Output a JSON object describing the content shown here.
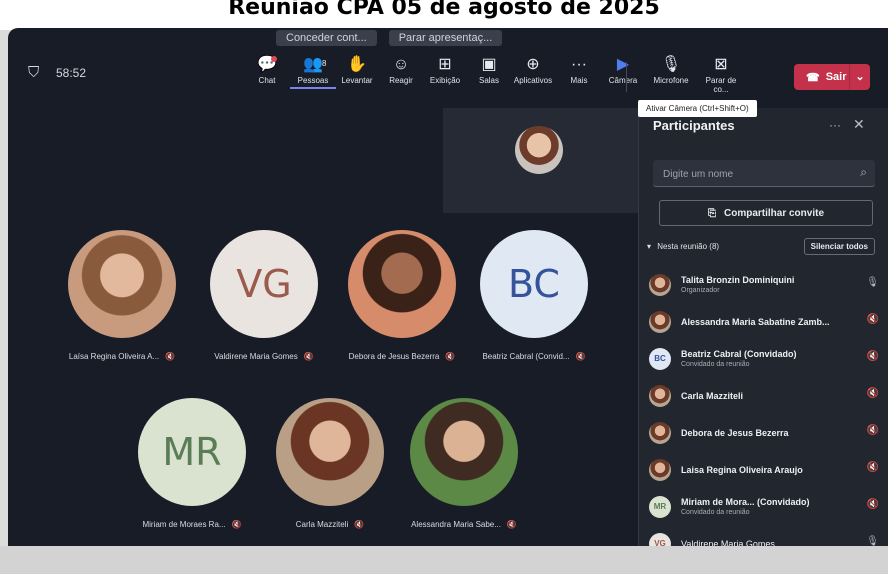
{
  "page": {
    "title": "Reunião CPA 05 de agosto de 2025"
  },
  "share_bar": {
    "left_text": "Conceder cont...",
    "stop_label": "Parar apresentaç...",
    "link_text": ""
  },
  "topbar": {
    "timer": "58:52",
    "buttons": [
      {
        "label": "Chat",
        "icon": "chat-icon",
        "glyph": "💬"
      },
      {
        "label": "Pessoas",
        "icon": "people-icon",
        "glyph": "👥",
        "badge": "8"
      },
      {
        "label": "Levantar",
        "icon": "raise-hand-icon",
        "glyph": "✋"
      },
      {
        "label": "Reagir",
        "icon": "react-icon",
        "glyph": "☺"
      },
      {
        "label": "Exibição",
        "icon": "view-icon",
        "glyph": "⊞"
      },
      {
        "label": "Salas",
        "icon": "rooms-icon",
        "glyph": "▣"
      },
      {
        "label": "Aplicativos",
        "icon": "apps-icon",
        "glyph": "⊕"
      },
      {
        "label": "Mais",
        "icon": "more-icon",
        "glyph": "···"
      },
      {
        "label": "Câmera",
        "icon": "camera-icon",
        "glyph": "▶"
      },
      {
        "label": "Microfone",
        "icon": "microphone-icon",
        "glyph": "🎙"
      },
      {
        "label": "Parar de co...",
        "icon": "stop-share-icon",
        "glyph": "⊠"
      }
    ],
    "leave_label": "Sair",
    "tooltip": "Ativar Câmera (Ctrl+Shift+O)"
  },
  "participants_grid": {
    "row1": [
      {
        "name": "Laísa Regina Oliveira A...",
        "type": "photo1",
        "initials": ""
      },
      {
        "name": "Valdirene Maria Gomes",
        "type": "vg",
        "initials": "VG"
      },
      {
        "name": "Debora de Jesus Bezerra",
        "type": "photo2",
        "initials": ""
      },
      {
        "name": "Beatriz Cabral (Convid...",
        "type": "bc",
        "initials": "BC"
      }
    ],
    "row2": [
      {
        "name": "Miriam de Moraes Ra...",
        "type": "mr",
        "initials": "MR"
      },
      {
        "name": "Carla Mazziteli",
        "type": "photo3",
        "initials": ""
      },
      {
        "name": "Alessandra Maria Sabe...",
        "type": "photo4",
        "initials": ""
      }
    ]
  },
  "panel": {
    "title": "Participantes",
    "search_placeholder": "Digite um nome",
    "invite_label": "Compartilhar convite",
    "section_label": "Nesta reunião (8)",
    "mute_all_label": "Silenciar todos",
    "participants": [
      {
        "name": "Talita Bronzin Dominiquini",
        "sub": "Organizador",
        "avatar": "ph",
        "initials": "",
        "status_icon": "mic-on-icon",
        "glyph": "🎙"
      },
      {
        "name": "Alessandra Maria Sabatine Zamb...",
        "sub": "",
        "avatar": "ph",
        "initials": "",
        "status_icon": "mic-off-icon",
        "glyph": "🔇"
      },
      {
        "name": "Beatriz Cabral (Convidado)",
        "sub": "Convidado da reunião",
        "avatar": "init-bc",
        "initials": "BC",
        "status_icon": "mic-off-icon",
        "glyph": "🔇"
      },
      {
        "name": "Carla Mazziteli",
        "sub": "",
        "avatar": "ph",
        "initials": "",
        "status_icon": "mic-off-icon",
        "glyph": "🔇"
      },
      {
        "name": "Debora de Jesus Bezerra",
        "sub": "",
        "avatar": "ph",
        "initials": "",
        "status_icon": "mic-off-icon",
        "glyph": "🔇"
      },
      {
        "name": "Laisa Regina Oliveira Araujo",
        "sub": "",
        "avatar": "ph",
        "initials": "",
        "status_icon": "mic-off-icon",
        "glyph": "🔇"
      },
      {
        "name": "Miriam de Mora... (Convidado)",
        "sub": "Convidado da reunião",
        "avatar": "init-mr",
        "initials": "MR",
        "status_icon": "mic-off-icon",
        "glyph": "🔇"
      },
      {
        "name": "Valdirene Maria Gomes",
        "sub": "",
        "avatar": "init-vg",
        "initials": "VG",
        "status_icon": "mic-on-icon",
        "glyph": "🎙"
      }
    ]
  }
}
